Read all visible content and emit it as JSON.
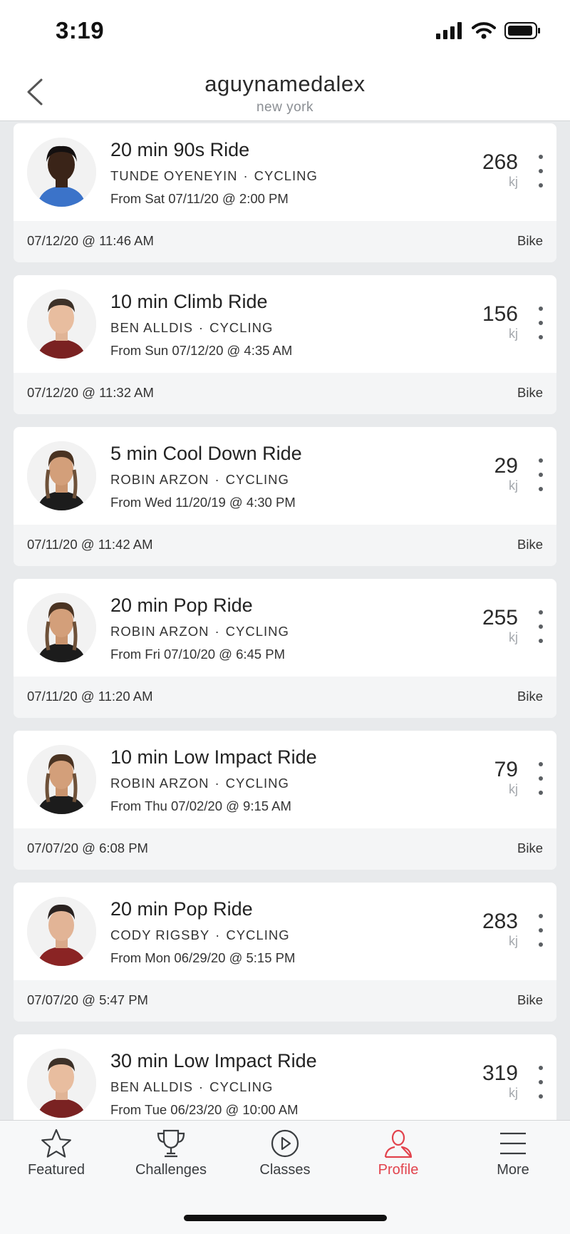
{
  "status_bar": {
    "time": "3:19"
  },
  "header": {
    "title": "aguynamedalex",
    "subtitle": "new york"
  },
  "workouts": [
    {
      "title": "20 min 90s Ride",
      "instructor": "TUNDE OYENEYIN",
      "discipline": "CYCLING",
      "from": "From Sat 07/11/20 @ 2:00 PM",
      "energy": "268",
      "unit": "kj",
      "completed": "07/12/20 @ 11:46 AM",
      "platform": "Bike"
    },
    {
      "title": "10 min Climb Ride",
      "instructor": "BEN ALLDIS",
      "discipline": "CYCLING",
      "from": "From Sun 07/12/20 @ 4:35 AM",
      "energy": "156",
      "unit": "kj",
      "completed": "07/12/20 @ 11:32 AM",
      "platform": "Bike"
    },
    {
      "title": "5 min Cool Down Ride",
      "instructor": "ROBIN ARZON",
      "discipline": "CYCLING",
      "from": "From Wed 11/20/19 @ 4:30 PM",
      "energy": "29",
      "unit": "kj",
      "completed": "07/11/20 @ 11:42 AM",
      "platform": "Bike"
    },
    {
      "title": "20 min Pop Ride",
      "instructor": "ROBIN ARZON",
      "discipline": "CYCLING",
      "from": "From Fri 07/10/20 @ 6:45 PM",
      "energy": "255",
      "unit": "kj",
      "completed": "07/11/20 @ 11:20 AM",
      "platform": "Bike"
    },
    {
      "title": "10 min Low Impact Ride",
      "instructor": "ROBIN ARZON",
      "discipline": "CYCLING",
      "from": "From Thu 07/02/20 @ 9:15 AM",
      "energy": "79",
      "unit": "kj",
      "completed": "07/07/20 @ 6:08 PM",
      "platform": "Bike"
    },
    {
      "title": "20 min Pop Ride",
      "instructor": "CODY RIGSBY",
      "discipline": "CYCLING",
      "from": "From Mon 06/29/20 @ 5:15 PM",
      "energy": "283",
      "unit": "kj",
      "completed": "07/07/20 @ 5:47 PM",
      "platform": "Bike"
    },
    {
      "title": "30 min Low Impact Ride",
      "instructor": "BEN ALLDIS",
      "discipline": "CYCLING",
      "from": "From Tue 06/23/20 @ 10:00 AM",
      "energy": "319",
      "unit": "kj",
      "completed": "",
      "platform": ""
    }
  ],
  "tabs": [
    {
      "label": "Featured",
      "icon": "star-icon",
      "active": false
    },
    {
      "label": "Challenges",
      "icon": "trophy-icon",
      "active": false
    },
    {
      "label": "Classes",
      "icon": "play-circle-icon",
      "active": false
    },
    {
      "label": "Profile",
      "icon": "person-icon",
      "active": true
    },
    {
      "label": "More",
      "icon": "menu-icon",
      "active": false
    }
  ],
  "colors": {
    "accent": "#e2434d",
    "background": "#e8eaec",
    "card": "#ffffff",
    "card_footer": "#f4f5f6"
  }
}
